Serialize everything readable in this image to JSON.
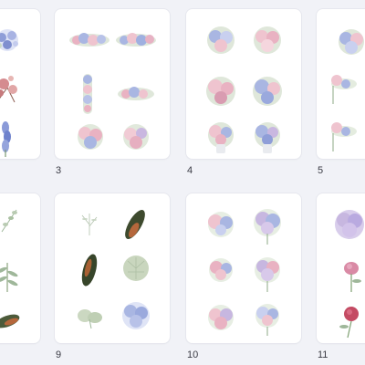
{
  "thumbnails": [
    {
      "page_number": "",
      "description": "bouquets-left-partial"
    },
    {
      "page_number": "3",
      "description": "floral-borders"
    },
    {
      "page_number": "4",
      "description": "bouquets"
    },
    {
      "page_number": "5",
      "description": "floral-corners"
    },
    {
      "page_number": "",
      "description": "leaves-left-partial"
    },
    {
      "page_number": "9",
      "description": "leaves"
    },
    {
      "page_number": "10",
      "description": "hydrangeas"
    },
    {
      "page_number": "11",
      "description": "hydrangea-buds"
    }
  ],
  "page_number_labels": [
    "3",
    "4",
    "5",
    "9",
    "10",
    "11"
  ],
  "colors": {
    "background": "#f1f2f7",
    "card": "#ffffff",
    "pink": "#e9b2c2",
    "blue": "#a9b6e2",
    "lavender": "#c7b7e0",
    "green": "#9fb79a",
    "dark_leaf": "#4c5a3a",
    "rust": "#b5673c"
  }
}
